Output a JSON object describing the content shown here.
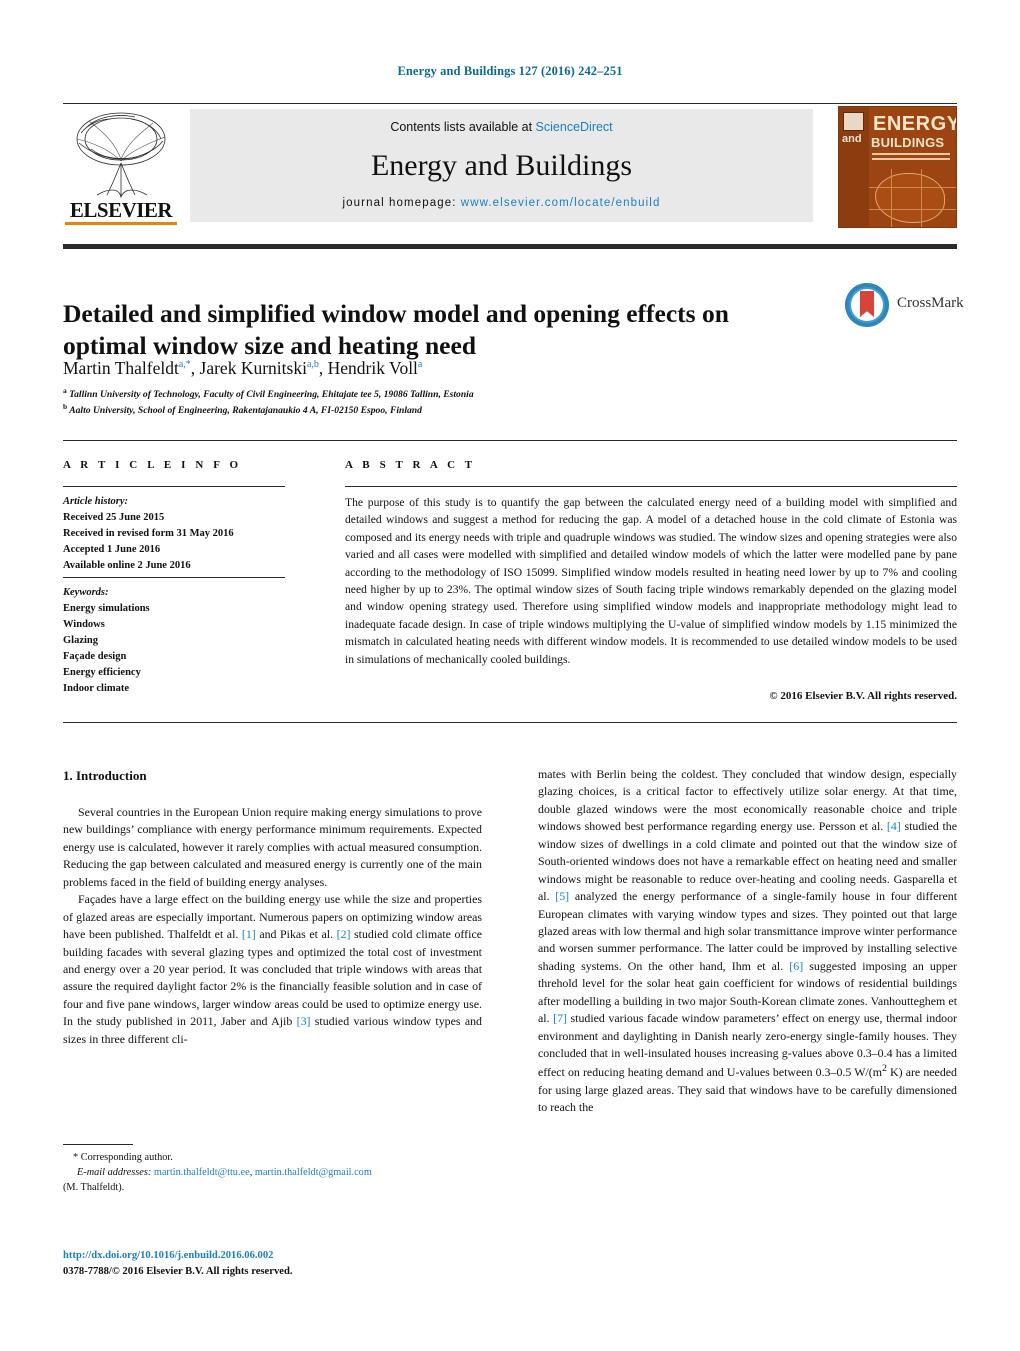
{
  "running_head": "Energy and Buildings 127 (2016) 242–251",
  "masthead": {
    "contents_prefix": "Contents lists available at ",
    "sciencedirect": "ScienceDirect",
    "journal_name": "Energy and Buildings",
    "homepage_prefix": "journal homepage: ",
    "homepage_url": "www.elsevier.com/locate/enbuild",
    "publisher": "ELSEVIER",
    "cover": {
      "and": "and",
      "energy": "ENERGY",
      "buildings": "BUILDINGS"
    }
  },
  "article": {
    "title": "Detailed and simplified window model and opening effects on optimal window size and heating need",
    "authors": "Martin Thalfeldt, Jarek Kurnitski, Hendrik Voll",
    "author_list": [
      {
        "name": "Martin Thalfeldt",
        "marks": "a,*"
      },
      {
        "name": "Jarek Kurnitski",
        "marks": "a,b"
      },
      {
        "name": "Hendrik Voll",
        "marks": "a"
      }
    ],
    "affiliations": [
      {
        "mark": "a",
        "text": "Tallinn University of Technology, Faculty of Civil Engineering, Ehitajate tee 5, 19086 Tallinn, Estonia"
      },
      {
        "mark": "b",
        "text": "Aalto University, School of Engineering, Rakentajanaukio 4 A, FI-02150 Espoo, Finland"
      }
    ],
    "crossmark_label": "CrossMark"
  },
  "article_info": {
    "heading": "A R T I C L E   I N F O",
    "history_label": "Article history:",
    "history": [
      "Received 25 June 2015",
      "Received in revised form 31 May 2016",
      "Accepted 1 June 2016",
      "Available online 2 June 2016"
    ],
    "keywords_label": "Keywords:",
    "keywords": [
      "Energy simulations",
      "Windows",
      "Glazing",
      "Façade design",
      "Energy efficiency",
      "Indoor climate"
    ]
  },
  "abstract": {
    "heading": "A B S T R A C T",
    "text": "The purpose of this study is to quantify the gap between the calculated energy need of a building model with simplified and detailed windows and suggest a method for reducing the gap. A model of a detached house in the cold climate of Estonia was composed and its energy needs with triple and quadruple windows was studied. The window sizes and opening strategies were also varied and all cases were modelled with simplified and detailed window models of which the latter were modelled pane by pane according to the methodology of ISO 15099. Simplified window models resulted in heating need lower by up to 7% and cooling need higher by up to 23%. The optimal window sizes of South facing triple windows remarkably depended on the glazing model and window opening strategy used. Therefore using simplified window models and inappropriate methodology might lead to inadequate facade design. In case of triple windows multiplying the U-value of simplified window models by 1.15 minimized the mismatch in calculated heating needs with different window models. It is recommended to use detailed window models to be used in simulations of mechanically cooled buildings.",
    "copyright": "© 2016 Elsevier B.V. All rights reserved."
  },
  "body": {
    "section_heading": "1.  Introduction",
    "left_paragraphs": [
      "Several countries in the European Union require making energy simulations to prove new buildings’ compliance with energy performance minimum requirements. Expected energy use is calculated, however it rarely complies with actual measured consumption. Reducing the gap between calculated and measured energy is currently one of the main problems faced in the field of building energy analyses.",
      "Façades have a large effect on the building energy use while the size and properties of glazed areas are especially important. Numerous papers on optimizing window areas have been published. Thalfeldt et al. [1] and Pikas et al. [2] studied cold climate office building facades with several glazing types and optimized the total cost of investment and energy over a 20 year period. It was concluded that triple windows with areas that assure the required daylight factor 2% is the financially feasible solution and in case of four and five pane windows, larger window areas could be used to optimize energy use. In the study published in 2011, Jaber and Ajib [3] studied various window types and sizes in three different cli-"
    ],
    "right_paragraphs": [
      "mates with Berlin being the coldest. They concluded that window design, especially glazing choices, is a critical factor to effectively utilize solar energy. At that time, double glazed windows were the most economically reasonable choice and triple windows showed best performance regarding energy use. Persson et al. [4] studied the window sizes of dwellings in a cold climate and pointed out that the window size of South-oriented windows does not have a remarkable effect on heating need and smaller windows might be reasonable to reduce over-heating and cooling needs. Gasparella et al. [5] analyzed the energy performance of a single-family house in four different European climates with varying window types and sizes. They pointed out that large glazed areas with low thermal and high solar transmittance improve winter performance and worsen summer performance. The latter could be improved by installing selective shading systems. On the other hand, Ihm et al. [6] suggested imposing an upper threhold level for the solar heat gain coefficient for windows of residential buildings after modelling a building in two major South-Korean climate zones. Vanhoutteghem et al. [7] studied various facade window parameters’ effect on energy use, thermal indoor environment and daylighting in Danish nearly zero-energy single-family houses. They concluded that in well-insulated houses increasing g-values above 0.3–0.4 has a limited effect on reducing heating demand and U-values between 0.3–0.5 W/(m2 K) are needed for using large glazed areas. They said that windows have to be carefully dimensioned to reach the"
    ],
    "citations": [
      "[1]",
      "[2]",
      "[3]",
      "[4]",
      "[5]",
      "[6]",
      "[7]"
    ]
  },
  "footnote": {
    "corresponding": "* Corresponding author.",
    "email_label": "E-mail addresses:",
    "email_1": "martin.thalfeldt@ttu.ee",
    "email_2": "martin.thalfeldt@gmail.com",
    "email_attrib": "(M. Thalfeldt)."
  },
  "footer": {
    "doi": "http://dx.doi.org/10.1016/j.enbuild.2016.06.002",
    "issn_line": "0378-7788/© 2016 Elsevier B.V. All rights reserved."
  },
  "colors": {
    "link": "#1b7fc4",
    "header_blue": "#0b6a9a",
    "elsevier_orange": "#f08000",
    "cover_brown": "#9c4512",
    "crossmark_blue": "#3d9fd4",
    "crossmark_red": "#d8443a"
  }
}
